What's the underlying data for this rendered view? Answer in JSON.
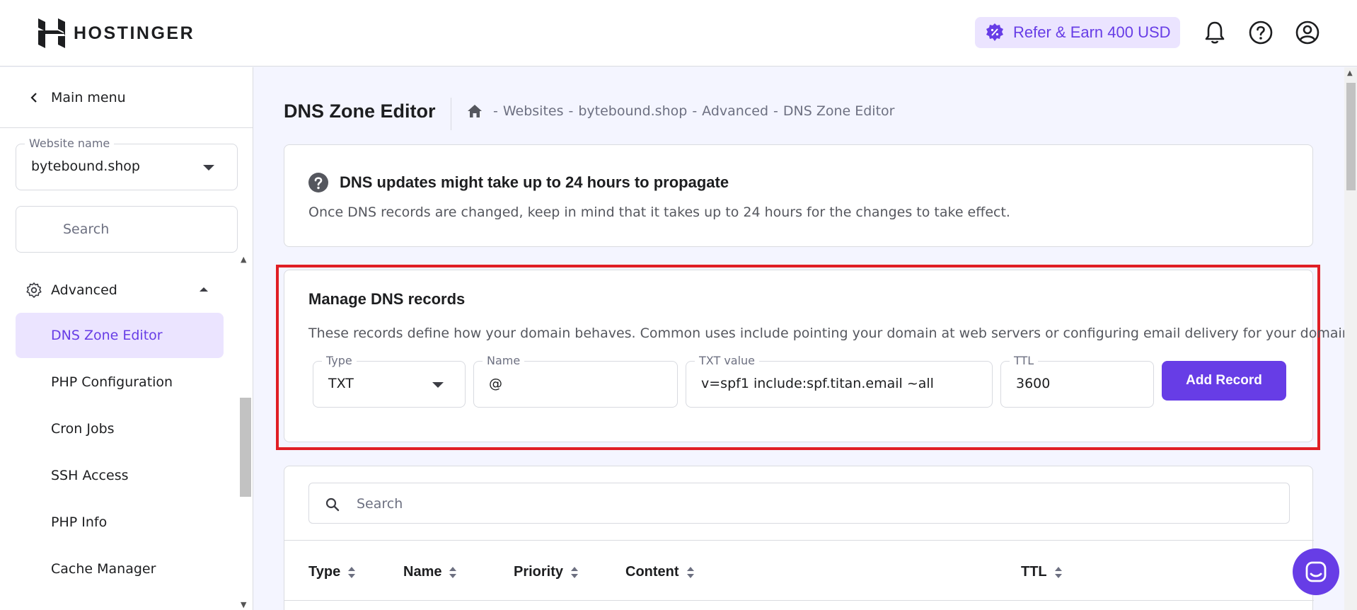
{
  "brand": {
    "name": "HOSTINGER"
  },
  "header": {
    "refer_label": "Refer & Earn 400 USD",
    "accent": "#673de6"
  },
  "sidebar": {
    "main_menu": "Main menu",
    "website_label": "Website name",
    "website_value": "bytebound.shop",
    "search_placeholder": "Search",
    "group_label": "Advanced",
    "items": [
      {
        "label": "DNS Zone Editor",
        "active": true
      },
      {
        "label": "PHP Configuration"
      },
      {
        "label": "Cron Jobs"
      },
      {
        "label": "SSH Access"
      },
      {
        "label": "PHP Info"
      },
      {
        "label": "Cache Manager"
      }
    ]
  },
  "page": {
    "title": "DNS Zone Editor",
    "breadcrumb": [
      "Websites",
      "bytebound.shop",
      "Advanced",
      "DNS Zone Editor"
    ]
  },
  "notice": {
    "title": "DNS updates might take up to 24 hours to propagate",
    "text": "Once DNS records are changed, keep in mind that it takes up to 24 hours for the changes to take effect."
  },
  "manage": {
    "title": "Manage DNS records",
    "description": "These records define how your domain behaves. Common uses include pointing your domain at web servers or configuring email delivery for your domain.",
    "fields": {
      "type_label": "Type",
      "type_value": "TXT",
      "name_label": "Name",
      "name_value": "@",
      "txt_label": "TXT value",
      "txt_value": "v=spf1 include:spf.titan.email ~all",
      "ttl_label": "TTL",
      "ttl_value": "3600"
    },
    "add_button": "Add Record"
  },
  "records_table": {
    "search_placeholder": "Search",
    "columns": [
      "Type",
      "Name",
      "Priority",
      "Content",
      "TTL"
    ]
  }
}
